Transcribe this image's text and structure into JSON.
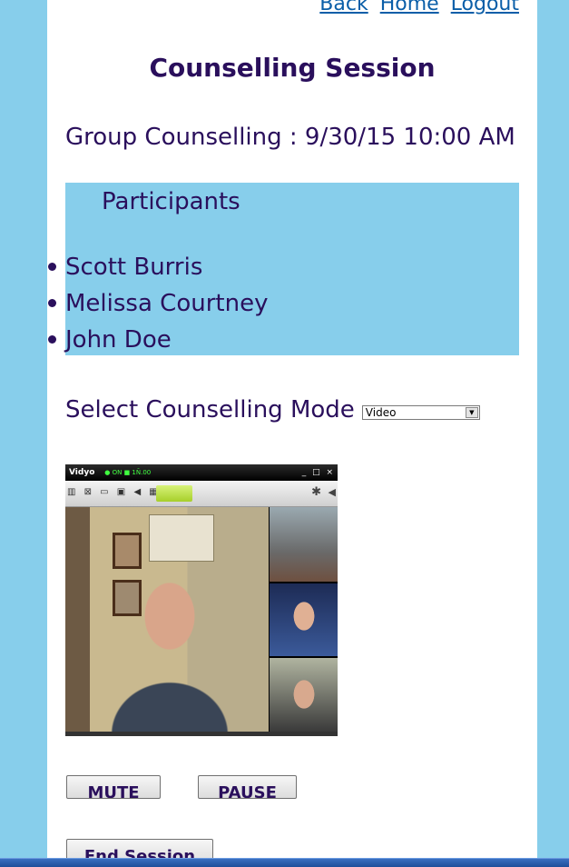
{
  "nav": {
    "back": "Back",
    "home": "Home",
    "logout": "Logout"
  },
  "page_title": "Counselling Session",
  "session": {
    "label": "Group Counselling : 9/30/15 10:00 AM"
  },
  "participants": {
    "heading": "Participants",
    "items": [
      "Scott Burris",
      "Melissa Courtney",
      "John Doe"
    ]
  },
  "mode": {
    "label": "Select Counselling Mode",
    "selected": "Video"
  },
  "video": {
    "app_name": "Vidyo",
    "status": "● ON ■ 1Ñ.00"
  },
  "buttons": {
    "mute": "MUTE",
    "pause": "PAUSE",
    "end": "End Session"
  },
  "colors": {
    "background": "#87ceeb",
    "text": "#2a0f5c",
    "link": "#0a5ea8"
  }
}
